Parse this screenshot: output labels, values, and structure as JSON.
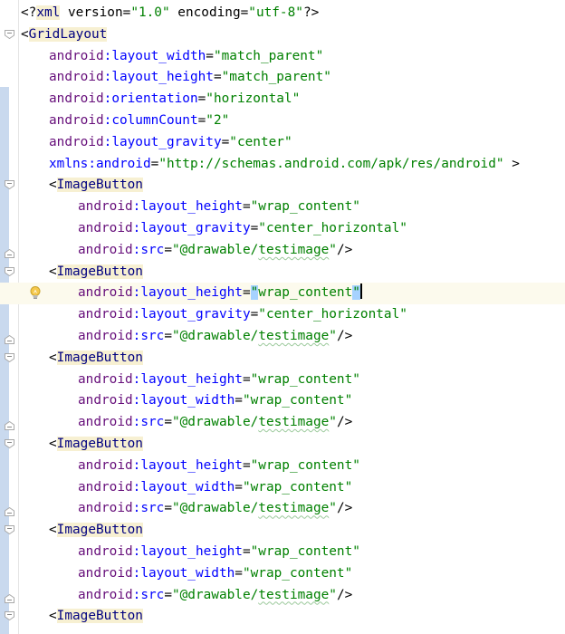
{
  "editor": {
    "lines": [
      {
        "indent": 0,
        "tokens": [
          {
            "t": "<?",
            "c": "t-decl"
          },
          {
            "t": "xml",
            "c": "t-tag"
          },
          {
            "t": " version=",
            "c": "t-decl"
          },
          {
            "t": "\"1.0\"",
            "c": "t-val"
          },
          {
            "t": " encoding=",
            "c": "t-decl"
          },
          {
            "t": "\"utf-8\"",
            "c": "t-val"
          },
          {
            "t": "?>",
            "c": "t-decl"
          }
        ]
      },
      {
        "indent": 0,
        "tokens": [
          {
            "t": "<",
            "c": "t-punc"
          },
          {
            "t": "GridLayout",
            "c": "t-tag"
          }
        ]
      },
      {
        "indent": 1,
        "tokens": [
          {
            "t": "android",
            "c": "t-ns"
          },
          {
            "t": ":layout_width",
            "c": "t-attr"
          },
          {
            "t": "=",
            "c": "t-eq"
          },
          {
            "t": "\"match_parent\"",
            "c": "t-val"
          }
        ]
      },
      {
        "indent": 1,
        "tokens": [
          {
            "t": "android",
            "c": "t-ns"
          },
          {
            "t": ":layout_height",
            "c": "t-attr"
          },
          {
            "t": "=",
            "c": "t-eq"
          },
          {
            "t": "\"match_parent\"",
            "c": "t-val"
          }
        ]
      },
      {
        "indent": 1,
        "tokens": [
          {
            "t": "android",
            "c": "t-ns"
          },
          {
            "t": ":orientation",
            "c": "t-attr"
          },
          {
            "t": "=",
            "c": "t-eq"
          },
          {
            "t": "\"horizontal\"",
            "c": "t-val"
          }
        ]
      },
      {
        "indent": 1,
        "tokens": [
          {
            "t": "android",
            "c": "t-ns"
          },
          {
            "t": ":columnCount",
            "c": "t-attr"
          },
          {
            "t": "=",
            "c": "t-eq"
          },
          {
            "t": "\"2\"",
            "c": "t-val"
          }
        ]
      },
      {
        "indent": 1,
        "tokens": [
          {
            "t": "android",
            "c": "t-ns"
          },
          {
            "t": ":layout_gravity",
            "c": "t-attr"
          },
          {
            "t": "=",
            "c": "t-eq"
          },
          {
            "t": "\"center\"",
            "c": "t-val"
          }
        ]
      },
      {
        "indent": 1,
        "tokens": [
          {
            "t": "xmlns:android",
            "c": "t-xmlns"
          },
          {
            "t": "=",
            "c": "t-eq"
          },
          {
            "t": "\"http://schemas.android.com/apk/res/android\"",
            "c": "t-val"
          },
          {
            "t": " >",
            "c": "t-punc"
          }
        ]
      },
      {
        "indent": 1,
        "tokens": [
          {
            "t": "<",
            "c": "t-punc"
          },
          {
            "t": "ImageButton",
            "c": "t-tag"
          }
        ]
      },
      {
        "indent": 2,
        "tokens": [
          {
            "t": "android",
            "c": "t-ns"
          },
          {
            "t": ":layout_height",
            "c": "t-attr"
          },
          {
            "t": "=",
            "c": "t-eq"
          },
          {
            "t": "\"wrap_content\"",
            "c": "t-val"
          }
        ]
      },
      {
        "indent": 2,
        "tokens": [
          {
            "t": "android",
            "c": "t-ns"
          },
          {
            "t": ":layout_gravity",
            "c": "t-attr"
          },
          {
            "t": "=",
            "c": "t-eq"
          },
          {
            "t": "\"center_horizontal\"",
            "c": "t-val"
          }
        ]
      },
      {
        "indent": 2,
        "tokens": [
          {
            "t": "android",
            "c": "t-ns"
          },
          {
            "t": ":src",
            "c": "t-attr"
          },
          {
            "t": "=",
            "c": "t-eq"
          },
          {
            "t": "\"@drawable/",
            "c": "t-val"
          },
          {
            "t": "testimage",
            "c": "t-val squig"
          },
          {
            "t": "\"",
            "c": "t-val"
          },
          {
            "t": "/>",
            "c": "t-punc"
          }
        ]
      },
      {
        "indent": 1,
        "tokens": [
          {
            "t": "<",
            "c": "t-punc"
          },
          {
            "t": "ImageButton",
            "c": "t-tag"
          }
        ]
      },
      {
        "indent": 2,
        "current": true,
        "tokens": [
          {
            "t": "android",
            "c": "t-ns"
          },
          {
            "t": ":layout_height",
            "c": "t-attr"
          },
          {
            "t": "=",
            "c": "t-eq"
          },
          {
            "t": "\"",
            "c": "t-val sel-quote"
          },
          {
            "t": "wrap_content",
            "c": "t-val"
          },
          {
            "t": "\"",
            "c": "t-val sel-quote"
          },
          {
            "t": "",
            "c": "caret"
          }
        ]
      },
      {
        "indent": 2,
        "tokens": [
          {
            "t": "android",
            "c": "t-ns"
          },
          {
            "t": ":layout_gravity",
            "c": "t-attr"
          },
          {
            "t": "=",
            "c": "t-eq"
          },
          {
            "t": "\"center_horizontal\"",
            "c": "t-val"
          }
        ]
      },
      {
        "indent": 2,
        "tokens": [
          {
            "t": "android",
            "c": "t-ns"
          },
          {
            "t": ":src",
            "c": "t-attr"
          },
          {
            "t": "=",
            "c": "t-eq"
          },
          {
            "t": "\"@drawable/",
            "c": "t-val"
          },
          {
            "t": "testimage",
            "c": "t-val squig"
          },
          {
            "t": "\"",
            "c": "t-val"
          },
          {
            "t": "/>",
            "c": "t-punc"
          }
        ]
      },
      {
        "indent": 1,
        "tokens": [
          {
            "t": "<",
            "c": "t-punc"
          },
          {
            "t": "ImageButton",
            "c": "t-tag"
          }
        ]
      },
      {
        "indent": 2,
        "tokens": [
          {
            "t": "android",
            "c": "t-ns"
          },
          {
            "t": ":layout_height",
            "c": "t-attr"
          },
          {
            "t": "=",
            "c": "t-eq"
          },
          {
            "t": "\"wrap_content\"",
            "c": "t-val"
          }
        ]
      },
      {
        "indent": 2,
        "tokens": [
          {
            "t": "android",
            "c": "t-ns"
          },
          {
            "t": ":layout_width",
            "c": "t-attr"
          },
          {
            "t": "=",
            "c": "t-eq"
          },
          {
            "t": "\"wrap_content\"",
            "c": "t-val"
          }
        ]
      },
      {
        "indent": 2,
        "tokens": [
          {
            "t": "android",
            "c": "t-ns"
          },
          {
            "t": ":src",
            "c": "t-attr"
          },
          {
            "t": "=",
            "c": "t-eq"
          },
          {
            "t": "\"@drawable/",
            "c": "t-val"
          },
          {
            "t": "testimage",
            "c": "t-val squig"
          },
          {
            "t": "\"",
            "c": "t-val"
          },
          {
            "t": "/>",
            "c": "t-punc"
          }
        ]
      },
      {
        "indent": 1,
        "tokens": [
          {
            "t": "<",
            "c": "t-punc"
          },
          {
            "t": "ImageButton",
            "c": "t-tag"
          }
        ]
      },
      {
        "indent": 2,
        "tokens": [
          {
            "t": "android",
            "c": "t-ns"
          },
          {
            "t": ":layout_height",
            "c": "t-attr"
          },
          {
            "t": "=",
            "c": "t-eq"
          },
          {
            "t": "\"wrap_content\"",
            "c": "t-val"
          }
        ]
      },
      {
        "indent": 2,
        "tokens": [
          {
            "t": "android",
            "c": "t-ns"
          },
          {
            "t": ":layout_width",
            "c": "t-attr"
          },
          {
            "t": "=",
            "c": "t-eq"
          },
          {
            "t": "\"wrap_content\"",
            "c": "t-val"
          }
        ]
      },
      {
        "indent": 2,
        "tokens": [
          {
            "t": "android",
            "c": "t-ns"
          },
          {
            "t": ":src",
            "c": "t-attr"
          },
          {
            "t": "=",
            "c": "t-eq"
          },
          {
            "t": "\"@drawable/",
            "c": "t-val"
          },
          {
            "t": "testimage",
            "c": "t-val squig"
          },
          {
            "t": "\"",
            "c": "t-val"
          },
          {
            "t": "/>",
            "c": "t-punc"
          }
        ]
      },
      {
        "indent": 1,
        "tokens": [
          {
            "t": "<",
            "c": "t-punc"
          },
          {
            "t": "ImageButton",
            "c": "t-tag"
          }
        ]
      },
      {
        "indent": 2,
        "tokens": [
          {
            "t": "android",
            "c": "t-ns"
          },
          {
            "t": ":layout_height",
            "c": "t-attr"
          },
          {
            "t": "=",
            "c": "t-eq"
          },
          {
            "t": "\"wrap_content\"",
            "c": "t-val"
          }
        ]
      },
      {
        "indent": 2,
        "tokens": [
          {
            "t": "android",
            "c": "t-ns"
          },
          {
            "t": ":layout_width",
            "c": "t-attr"
          },
          {
            "t": "=",
            "c": "t-eq"
          },
          {
            "t": "\"wrap_content\"",
            "c": "t-val"
          }
        ]
      },
      {
        "indent": 2,
        "tokens": [
          {
            "t": "android",
            "c": "t-ns"
          },
          {
            "t": ":src",
            "c": "t-attr"
          },
          {
            "t": "=",
            "c": "t-eq"
          },
          {
            "t": "\"@drawable/",
            "c": "t-val"
          },
          {
            "t": "testimage",
            "c": "t-val squig"
          },
          {
            "t": "\"",
            "c": "t-val"
          },
          {
            "t": "/>",
            "c": "t-punc"
          }
        ]
      },
      {
        "indent": 1,
        "tokens": [
          {
            "t": "<",
            "c": "t-punc"
          },
          {
            "t": "ImageButton",
            "c": "t-tag"
          }
        ]
      }
    ],
    "fold_markers": [
      {
        "line": 1,
        "kind": "open"
      },
      {
        "line": 8,
        "kind": "open"
      },
      {
        "line": 11,
        "kind": "close"
      },
      {
        "line": 12,
        "kind": "open"
      },
      {
        "line": 15,
        "kind": "close"
      },
      {
        "line": 16,
        "kind": "open"
      },
      {
        "line": 19,
        "kind": "close"
      },
      {
        "line": 20,
        "kind": "open"
      },
      {
        "line": 23,
        "kind": "close"
      },
      {
        "line": 24,
        "kind": "open"
      },
      {
        "line": 27,
        "kind": "close"
      },
      {
        "line": 28,
        "kind": "open"
      }
    ],
    "intention_bulb_line": 13,
    "colors": {
      "tag": "#000080",
      "namespace": "#660e7a",
      "attribute": "#0000ff",
      "value": "#008000",
      "tag_highlight": "#f7f0d2",
      "current_line": "#fcfaed",
      "gutter_strip": "#c9d9ee"
    },
    "icons": {
      "fold_open": "fold-open-icon",
      "fold_close": "fold-close-icon",
      "intention": "lightbulb-icon"
    }
  }
}
